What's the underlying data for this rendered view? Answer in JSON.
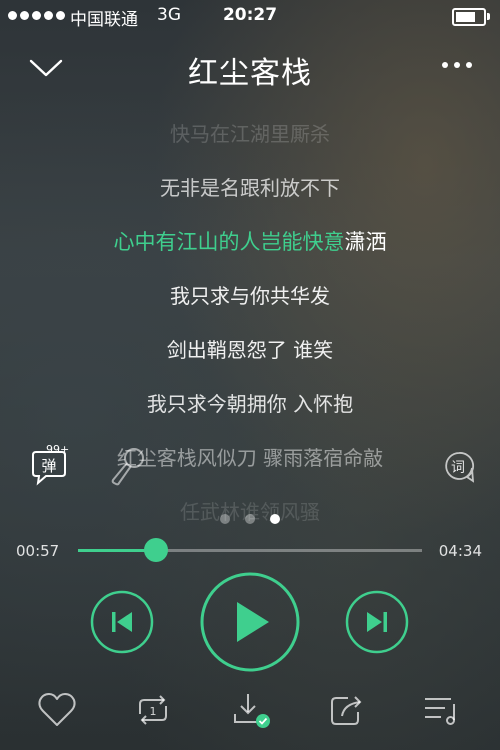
{
  "status_bar": {
    "carrier": "中国联通",
    "network": "3G",
    "time": "20:27",
    "battery_level": 0.72
  },
  "header": {
    "title": "红尘客栈"
  },
  "lyrics": {
    "lines": [
      "快马在江湖里厮杀",
      "无非是名跟利放不下",
      "心中有江山的人岂能快意潇洒",
      "我只求与你共华发",
      "剑出鞘恩怨了 谁笑",
      "我只求今朝拥你 入怀抱",
      "红尘客栈风似刀 骤雨落宿命敲",
      "任武林谁领风骚"
    ],
    "current_sung": "心中有江山的人岂能快意",
    "current_rest": "潇洒",
    "highlight_color": "#3fcf8e"
  },
  "side": {
    "danmu_label": "弹",
    "danmu_count": "99+",
    "lyric_button_label": "词"
  },
  "pager": {
    "count": 3,
    "active_index": 2
  },
  "progress": {
    "elapsed": "00:57",
    "total": "04:34",
    "fraction": 0.227
  },
  "icons": {
    "collapse": "chevron-down-icon",
    "more": "more-dots-icon",
    "danmu": "danmu-icon",
    "mic": "microphone-icon",
    "lyric": "lyric-icon",
    "prev": "skip-previous-icon",
    "play": "play-icon",
    "next": "skip-next-icon",
    "like": "heart-icon",
    "mode": "repeat-one-icon",
    "download": "download-done-icon",
    "share": "share-icon",
    "playlist": "playlist-icon"
  },
  "colors": {
    "accent": "#3fcf8e"
  }
}
